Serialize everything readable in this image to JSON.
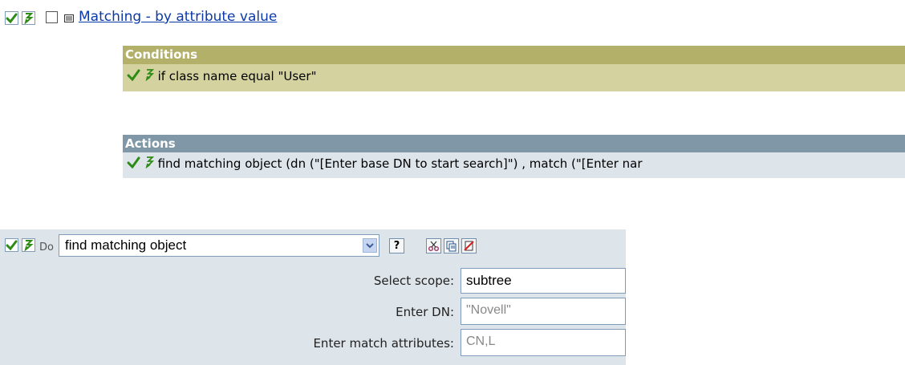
{
  "rule": {
    "title": "Matching - by attribute value"
  },
  "conditions": {
    "header": "Conditions",
    "items": [
      "if class name equal \"User\""
    ]
  },
  "actions": {
    "header": "Actions",
    "items": [
      "find matching object (dn (\"[Enter base DN to start search]\") , match (\"[Enter nar"
    ]
  },
  "editor": {
    "do_label": "Do",
    "action_value": "find matching object",
    "help_label": "?",
    "fields": [
      {
        "label": "Select scope:",
        "value": "subtree"
      },
      {
        "label": "Enter DN:",
        "value": "\"Novell\""
      },
      {
        "label": "Enter match attributes:",
        "value": "CN,L"
      }
    ]
  },
  "colors": {
    "conditions_header": "#b3b06a",
    "conditions_row": "#d4d3a0",
    "actions_header": "#7f97a6",
    "actions_row": "#dde4ea",
    "panel": "#dde4ea",
    "check_green": "#2e8b16"
  },
  "icons": [
    "check-icon",
    "enable-icon",
    "checkbox",
    "rule-icon",
    "chevron-down-icon",
    "help-icon",
    "cut-icon",
    "copy-icon",
    "delete-icon"
  ]
}
